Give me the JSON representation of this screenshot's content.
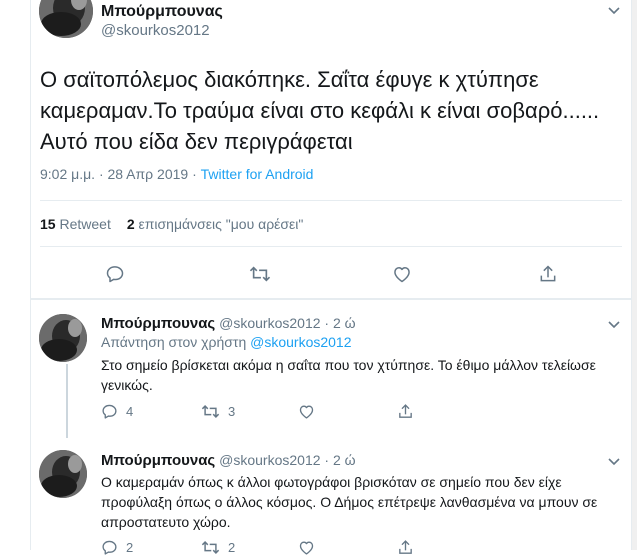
{
  "main_tweet": {
    "author_name": "Μπούρμπουνας",
    "author_handle": "@skourkos2012",
    "text": "Ο σαϊτοπόλεμος διακόπηκε. Σαΐτα έφυγε κ χτύπησε καμεραμαν.Το τραύμα είναι στο κεφάλι κ είναι σοβαρό...... Αυτό που είδα δεν περιγράφεται",
    "timestamp": "9:02 μ.μ. · 28 Απρ 2019 · ",
    "source": "Twitter for Android",
    "retweet_count": "15",
    "retweet_label": "Retweet",
    "like_count": "2",
    "like_label": "επισημάνσεις \"μου αρέσει\""
  },
  "replies": [
    {
      "author_name": "Μπούρμπουνας",
      "author_handle": "@skourkos2012 · 2 ώ",
      "reply_to_prefix": "Απάντηση στον χρήστη ",
      "reply_to_handle": "@skourkos2012",
      "text": "Στο σημείο βρίσκεται ακόμα η σαΐτα που τον χτύπησε. Το έθιμο μάλλον τελείωσε γενικώς.",
      "reply_count": "4",
      "retweet_count": "3"
    },
    {
      "author_name": "Μπούρμπουνας",
      "author_handle": "@skourkos2012 · 2 ώ",
      "text": "Ο καμεραμάν όπως κ άλλοι φωτογράφοι βρισκόταν σε σημείο που δεν είχε προφύλαξη όπως ο άλλος κόσμος. Ο Δήμος επέτρεψε λανθασμένα να μπουν σε απροστατευτο χώρο.",
      "reply_count": "2",
      "retweet_count": "2"
    }
  ],
  "colors": {
    "link": "#1da1f2",
    "muted": "#657786",
    "text": "#14171a",
    "divider": "#e6ecf0"
  },
  "icons": [
    "reply-icon",
    "retweet-icon",
    "like-icon",
    "share-icon",
    "caret-down-icon"
  ]
}
